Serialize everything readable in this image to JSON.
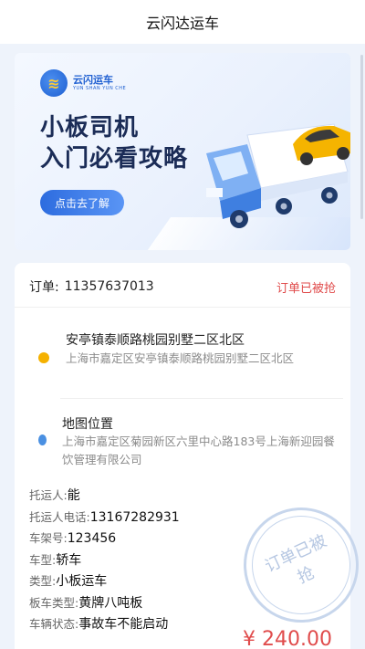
{
  "header": {
    "title": "云闪达运车"
  },
  "banner": {
    "logo_cn": "云闪运车",
    "logo_en": "YUN SHAN YUN CHE",
    "title_line1": "小板司机",
    "title_line2": "入门必看攻略",
    "button_label": "点击去了解"
  },
  "order": {
    "label": "订单:",
    "number": "11357637013",
    "status": "订单已被抢"
  },
  "pickup": {
    "title": "安亭镇泰顺路桃园别墅二区北区",
    "detail": "上海市嘉定区安亭镇泰顺路桃园别墅二区北区",
    "dot_color": "#f5b100"
  },
  "dropoff": {
    "title": "地图位置",
    "detail": "上海市嘉定区菊园新区六里中心路183号上海新迎园餐饮管理有限公司",
    "dot_color": "#4a90e2"
  },
  "info": [
    {
      "key": "托运人:",
      "value": "能"
    },
    {
      "key": "托运人电话:",
      "value": "13167282931"
    },
    {
      "key": "车架号:",
      "value": "123456"
    },
    {
      "key": "车型:",
      "value": "轿车"
    },
    {
      "key": "类型:",
      "value": "小板运车"
    },
    {
      "key": "板车类型:",
      "value": "黄牌八吨板"
    },
    {
      "key": "车辆状态:",
      "value": "事故车不能启动"
    }
  ],
  "stamp": {
    "text": "订单已被抢"
  },
  "price": "¥ 240.00",
  "colors": {
    "accent": "#2d6cdf",
    "status_red": "#e04c4c"
  }
}
